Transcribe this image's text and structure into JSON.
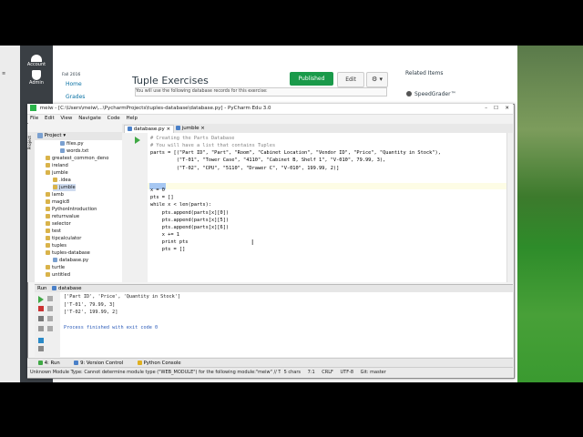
{
  "browser": {
    "left_nav": [
      {
        "label": "Account",
        "icon": "account-icon"
      },
      {
        "label": "Admin",
        "icon": "admin-shield-icon"
      }
    ],
    "course": {
      "term": "Fall 2016",
      "links": [
        "Home",
        "Grades"
      ]
    },
    "page_title": "Tuple Exercises",
    "buttons": {
      "published": "Published",
      "edit": "Edit",
      "gear": "⚙ ▾"
    },
    "page_intro": "You will use the following database records for this exercise:",
    "related_items": "Related Items",
    "speedgrader": "SpeedGrader™"
  },
  "pycharm": {
    "title": "meiw - [C:\\Users\\meiw\\...\\PycharmProjects\\tuples-database\\database.py] - PyCharm Edu 3.0",
    "menu": [
      "File",
      "Edit",
      "View",
      "Navigate",
      "Code",
      "Help"
    ],
    "tabs": [
      "database.py",
      "jumble"
    ],
    "project_label": "Project",
    "tree": [
      {
        "label": "files.py",
        "indent": 3
      },
      {
        "label": "words.txt",
        "indent": 3
      },
      {
        "label": "greatest_common_deno",
        "indent": 1
      },
      {
        "label": "ireland",
        "indent": 1
      },
      {
        "label": "jumble",
        "indent": 1
      },
      {
        "label": ".idea",
        "indent": 2
      },
      {
        "label": "jumble",
        "indent": 2,
        "selected": true
      },
      {
        "label": "lamb",
        "indent": 1
      },
      {
        "label": "magic8",
        "indent": 1
      },
      {
        "label": "PythonIntroduction",
        "indent": 1
      },
      {
        "label": "returnvalue",
        "indent": 1
      },
      {
        "label": "selector",
        "indent": 1
      },
      {
        "label": "test",
        "indent": 1
      },
      {
        "label": "tipcalculator",
        "indent": 1
      },
      {
        "label": "tuples",
        "indent": 1
      },
      {
        "label": "tuples-database",
        "indent": 1
      },
      {
        "label": "database.py",
        "indent": 2
      },
      {
        "label": "turtle",
        "indent": 1
      },
      {
        "label": "untitled",
        "indent": 1
      }
    ],
    "code_lines": [
      "# Creating the Parts Database",
      "# You will have a list that contains Tuples",
      "parts = [(\"Part ID\", \"Part\", \"Room\", \"Cabinet Location\", \"Vendor ID\", \"Price\", \"Quantity in Stock\"),",
      "         (\"T-01\", \"Tower Case\", \"4110\", \"Cabinet B, Shelf 1\", \"V-010\", 79.99, 3),",
      "         (\"T-02\", \"CPU\", \"5110\", \"Drawer C\", \"V-010\", 199.99, 2)]",
      "",
      "",
      "x = 0",
      "pts = []",
      "while x < len(parts):",
      "    pts.append(parts[x][0])",
      "    pts.append(parts[x][5])",
      "    pts.append(parts[x][6])",
      "    x += 1",
      "    print pts",
      "    pts = []"
    ],
    "run_tab_label": "Run",
    "run_config": "database",
    "output_lines": [
      "['Part ID', 'Price', 'Quantity in Stock']",
      "['T-01', 79.99, 3]",
      "['T-02', 199.99, 2]",
      "",
      "Process finished with exit code 0"
    ],
    "tool_tabs": [
      "4: Run",
      "9: Version Control",
      "Python Console"
    ],
    "status": {
      "message": "Unknown Module Type: Cannot determine module type (\"WEB_MODULE\") for the following module:\"meiw\" // The module will be treated as a Unkno... (today 8:50 PM)",
      "chars": "5 chars",
      "pos": "7:1",
      "le": "CRLF",
      "enc": "UTF-8",
      "git": "Git: master"
    }
  }
}
